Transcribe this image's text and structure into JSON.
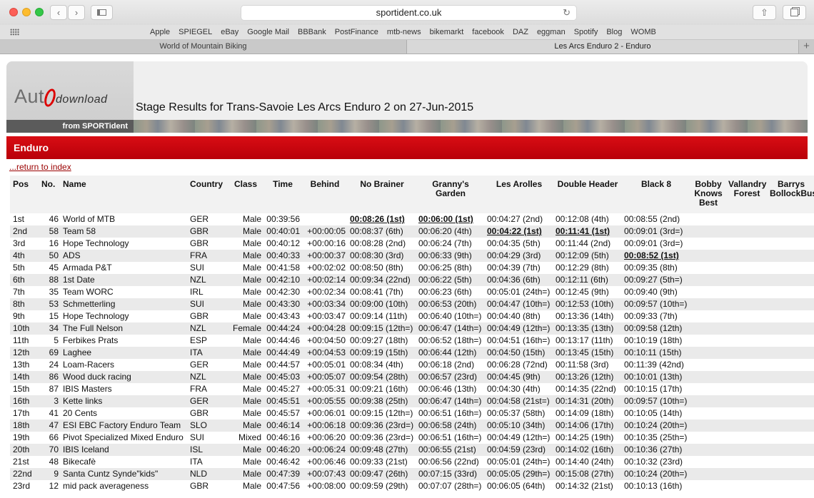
{
  "browser": {
    "url": "sportident.co.uk",
    "bookmarks": [
      "Apple",
      "SPIEGEL",
      "eBay",
      "Google Mail",
      "BBBank",
      "PostFinance",
      "mtb-news",
      "bikemarkt",
      "facebook",
      "DAZ",
      "eggman",
      "Spotify",
      "Blog",
      "WOMB"
    ],
    "tabs": [
      "World of Mountain Biking",
      "Les Arcs Enduro 2 - Enduro"
    ],
    "active_tab": 1
  },
  "header": {
    "logo_prefix": "Aut",
    "logo_suffix": "download",
    "logo_sub": "from SPORTident",
    "title": "Stage Results for Trans-Savoie Les Arcs Enduro 2 on 27-Jun-2015"
  },
  "section": {
    "title": "Enduro"
  },
  "return_link": "...return to index",
  "table": {
    "columns": [
      "Pos",
      "No.",
      "Name",
      "Country",
      "Class",
      "Time",
      "Behind",
      "No Brainer",
      "Granny's Garden",
      "Les Arolles",
      "Double Header",
      "Black 8",
      "Bobby Knows Best",
      "Vallandry Forest",
      "Barrys BollockBus"
    ],
    "rows": [
      [
        "1st",
        "46",
        "World of MTB",
        "GER",
        "Male",
        "00:39:56",
        "",
        "00:08:26 (1st)",
        "00:06:00 (1st)",
        "00:04:27 (2nd)",
        "00:12:08 (4th)",
        "00:08:55 (2nd)"
      ],
      [
        "2nd",
        "58",
        "Team 58",
        "GBR",
        "Male",
        "00:40:01",
        "+00:00:05",
        "00:08:37 (6th)",
        "00:06:20 (4th)",
        "00:04:22 (1st)",
        "00:11:41 (1st)",
        "00:09:01 (3rd=)"
      ],
      [
        "3rd",
        "16",
        "Hope Technology",
        "GBR",
        "Male",
        "00:40:12",
        "+00:00:16",
        "00:08:28 (2nd)",
        "00:06:24 (7th)",
        "00:04:35 (5th)",
        "00:11:44 (2nd)",
        "00:09:01 (3rd=)"
      ],
      [
        "4th",
        "50",
        "ADS",
        "FRA",
        "Male",
        "00:40:33",
        "+00:00:37",
        "00:08:30 (3rd)",
        "00:06:33 (9th)",
        "00:04:29 (3rd)",
        "00:12:09 (5th)",
        "00:08:52 (1st)"
      ],
      [
        "5th",
        "45",
        "Armada P&T",
        "SUI",
        "Male",
        "00:41:58",
        "+00:02:02",
        "00:08:50 (8th)",
        "00:06:25 (8th)",
        "00:04:39 (7th)",
        "00:12:29 (8th)",
        "00:09:35 (8th)"
      ],
      [
        "6th",
        "88",
        "1st Date",
        "NZL",
        "Male",
        "00:42:10",
        "+00:02:14",
        "00:09:34 (22nd)",
        "00:06:22 (5th)",
        "00:04:36 (6th)",
        "00:12:11 (6th)",
        "00:09:27 (5th=)"
      ],
      [
        "7th",
        "35",
        "Team WORC",
        "IRL",
        "Male",
        "00:42:30",
        "+00:02:34",
        "00:08:41 (7th)",
        "00:06:23 (6th)",
        "00:05:01 (24th=)",
        "00:12:45 (9th)",
        "00:09:40 (9th)"
      ],
      [
        "8th",
        "53",
        "Schmetterling",
        "SUI",
        "Male",
        "00:43:30",
        "+00:03:34",
        "00:09:00 (10th)",
        "00:06:53 (20th)",
        "00:04:47 (10th=)",
        "00:12:53 (10th)",
        "00:09:57 (10th=)"
      ],
      [
        "9th",
        "15",
        "Hope Technology",
        "GBR",
        "Male",
        "00:43:43",
        "+00:03:47",
        "00:09:14 (11th)",
        "00:06:40 (10th=)",
        "00:04:40 (8th)",
        "00:13:36 (14th)",
        "00:09:33 (7th)"
      ],
      [
        "10th",
        "34",
        "The Full Nelson",
        "NZL",
        "Female",
        "00:44:24",
        "+00:04:28",
        "00:09:15 (12th=)",
        "00:06:47 (14th=)",
        "00:04:49 (12th=)",
        "00:13:35 (13th)",
        "00:09:58 (12th)"
      ],
      [
        "11th",
        "5",
        "Ferbikes Prats",
        "ESP",
        "Male",
        "00:44:46",
        "+00:04:50",
        "00:09:27 (18th)",
        "00:06:52 (18th=)",
        "00:04:51 (16th=)",
        "00:13:17 (11th)",
        "00:10:19 (18th)"
      ],
      [
        "12th",
        "69",
        "Laghee",
        "ITA",
        "Male",
        "00:44:49",
        "+00:04:53",
        "00:09:19 (15th)",
        "00:06:44 (12th)",
        "00:04:50 (15th)",
        "00:13:45 (15th)",
        "00:10:11 (15th)"
      ],
      [
        "13th",
        "24",
        "Loam-Racers",
        "GER",
        "Male",
        "00:44:57",
        "+00:05:01",
        "00:08:34 (4th)",
        "00:06:18 (2nd)",
        "00:06:28 (72nd)",
        "00:11:58 (3rd)",
        "00:11:39 (42nd)"
      ],
      [
        "14th",
        "86",
        "Wood duck racing",
        "NZL",
        "Male",
        "00:45:03",
        "+00:05:07",
        "00:09:54 (28th)",
        "00:06:57 (23rd)",
        "00:04:45 (9th)",
        "00:13:26 (12th)",
        "00:10:01 (13th)"
      ],
      [
        "15th",
        "87",
        "IBIS Masters",
        "FRA",
        "Male",
        "00:45:27",
        "+00:05:31",
        "00:09:21 (16th)",
        "00:06:46 (13th)",
        "00:04:30 (4th)",
        "00:14:35 (22nd)",
        "00:10:15 (17th)"
      ],
      [
        "16th",
        "3",
        "Kette links",
        "GER",
        "Male",
        "00:45:51",
        "+00:05:55",
        "00:09:38 (25th)",
        "00:06:47 (14th=)",
        "00:04:58 (21st=)",
        "00:14:31 (20th)",
        "00:09:57 (10th=)"
      ],
      [
        "17th",
        "41",
        "20 Cents",
        "GBR",
        "Male",
        "00:45:57",
        "+00:06:01",
        "00:09:15 (12th=)",
        "00:06:51 (16th=)",
        "00:05:37 (58th)",
        "00:14:09 (18th)",
        "00:10:05 (14th)"
      ],
      [
        "18th",
        "47",
        "ESI EBC Factory Enduro Team",
        "SLO",
        "Male",
        "00:46:14",
        "+00:06:18",
        "00:09:36 (23rd=)",
        "00:06:58 (24th)",
        "00:05:10 (34th)",
        "00:14:06 (17th)",
        "00:10:24 (20th=)"
      ],
      [
        "19th",
        "66",
        "Pivot Specialized Mixed Enduro",
        "SUI",
        "Mixed",
        "00:46:16",
        "+00:06:20",
        "00:09:36 (23rd=)",
        "00:06:51 (16th=)",
        "00:04:49 (12th=)",
        "00:14:25 (19th)",
        "00:10:35 (25th=)"
      ],
      [
        "20th",
        "70",
        "IBIS Iceland",
        "ISL",
        "Male",
        "00:46:20",
        "+00:06:24",
        "00:09:48 (27th)",
        "00:06:55 (21st)",
        "00:04:59 (23rd)",
        "00:14:02 (16th)",
        "00:10:36 (27th)"
      ],
      [
        "21st",
        "48",
        "Bikecafè",
        "ITA",
        "Male",
        "00:46:42",
        "+00:06:46",
        "00:09:33 (21st)",
        "00:06:56 (22nd)",
        "00:05:01 (24th=)",
        "00:14:40 (24th)",
        "00:10:32 (23rd)"
      ],
      [
        "22nd",
        "9",
        "Santa Cuntz Synde\"kids\"",
        "NLD",
        "Male",
        "00:47:39",
        "+00:07:43",
        "00:09:47 (26th)",
        "00:07:15 (33rd)",
        "00:05:05 (29th=)",
        "00:15:08 (27th)",
        "00:10:24 (20th=)"
      ],
      [
        "23rd",
        "12",
        "mid pack averageness",
        "GBR",
        "Male",
        "00:47:56",
        "+00:08:00",
        "00:09:59 (29th)",
        "00:07:07 (28th=)",
        "00:06:05 (64th)",
        "00:14:32 (21st)",
        "00:10:13 (16th)"
      ]
    ]
  }
}
